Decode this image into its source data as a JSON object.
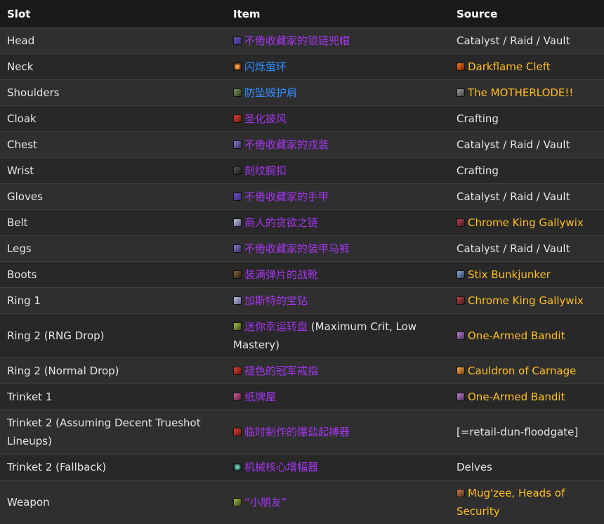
{
  "headers": {
    "slot": "Slot",
    "item": "Item",
    "source": "Source"
  },
  "rows": [
    {
      "slot": "Head",
      "item": "不倦收藏家的锁链兜帽",
      "item_note": "",
      "source": "Catalyst / Raid / Vault",
      "source_link": false
    },
    {
      "slot": "Neck",
      "item": "闪烁萤环",
      "item_note": "",
      "source": "Darkflame Cleft",
      "source_link": true
    },
    {
      "slot": "Shoulders",
      "item": "防坠毁护肩",
      "item_note": "",
      "source": "The MOTHERLODE!!",
      "source_link": true
    },
    {
      "slot": "Cloak",
      "item": "圣化披风",
      "item_note": "",
      "source": "Crafting",
      "source_link": false
    },
    {
      "slot": "Chest",
      "item": "不倦收藏家的戎装",
      "item_note": "",
      "source": "Catalyst / Raid / Vault",
      "source_link": false
    },
    {
      "slot": "Wrist",
      "item": "刻纹腕扣",
      "item_note": "",
      "source": "Crafting",
      "source_link": false
    },
    {
      "slot": "Gloves",
      "item": "不倦收藏家的手甲",
      "item_note": "",
      "source": "Catalyst / Raid / Vault",
      "source_link": false
    },
    {
      "slot": "Belt",
      "item": "商人的贪欲之链",
      "item_note": "",
      "source": "Chrome King Gallywix",
      "source_link": true
    },
    {
      "slot": "Legs",
      "item": "不倦收藏家的装甲马裤",
      "item_note": "",
      "source": "Catalyst / Raid / Vault",
      "source_link": false
    },
    {
      "slot": "Boots",
      "item": "装满弹片的战靴",
      "item_note": "",
      "source": "Stix Bunkjunker",
      "source_link": true
    },
    {
      "slot": "Ring 1",
      "item": "加斯特的宝钻",
      "item_note": "",
      "source": "Chrome King Gallywix",
      "source_link": true
    },
    {
      "slot": "Ring 2 (RNG Drop)",
      "item": "迷你幸运转盘",
      "item_note": " (Maximum Crit, Low Mastery)",
      "source": "One-Armed Bandit",
      "source_link": true
    },
    {
      "slot": "Ring 2 (Normal Drop)",
      "item": "褪色的冠军戒指",
      "item_note": "",
      "source": "Cauldron of Carnage",
      "source_link": true
    },
    {
      "slot": "Trinket 1",
      "item": "纸牌屋",
      "item_note": "",
      "source": "One-Armed Bandit",
      "source_link": true
    },
    {
      "slot": "Trinket 2 (Assuming Decent Trueshot Lineups)",
      "item": "临时制作的爆盐起搏器",
      "item_note": "",
      "source": "[=retail-dun-floodgate]",
      "source_link": false
    },
    {
      "slot": "Trinket 2 (Fallback)",
      "item": "机械核心增幅器",
      "item_note": "",
      "source": "Delves",
      "source_link": false
    },
    {
      "slot": "Weapon",
      "item": "“小朋友”",
      "item_note": "",
      "source": "Mug'zee, Heads of Security",
      "source_link": true
    }
  ]
}
